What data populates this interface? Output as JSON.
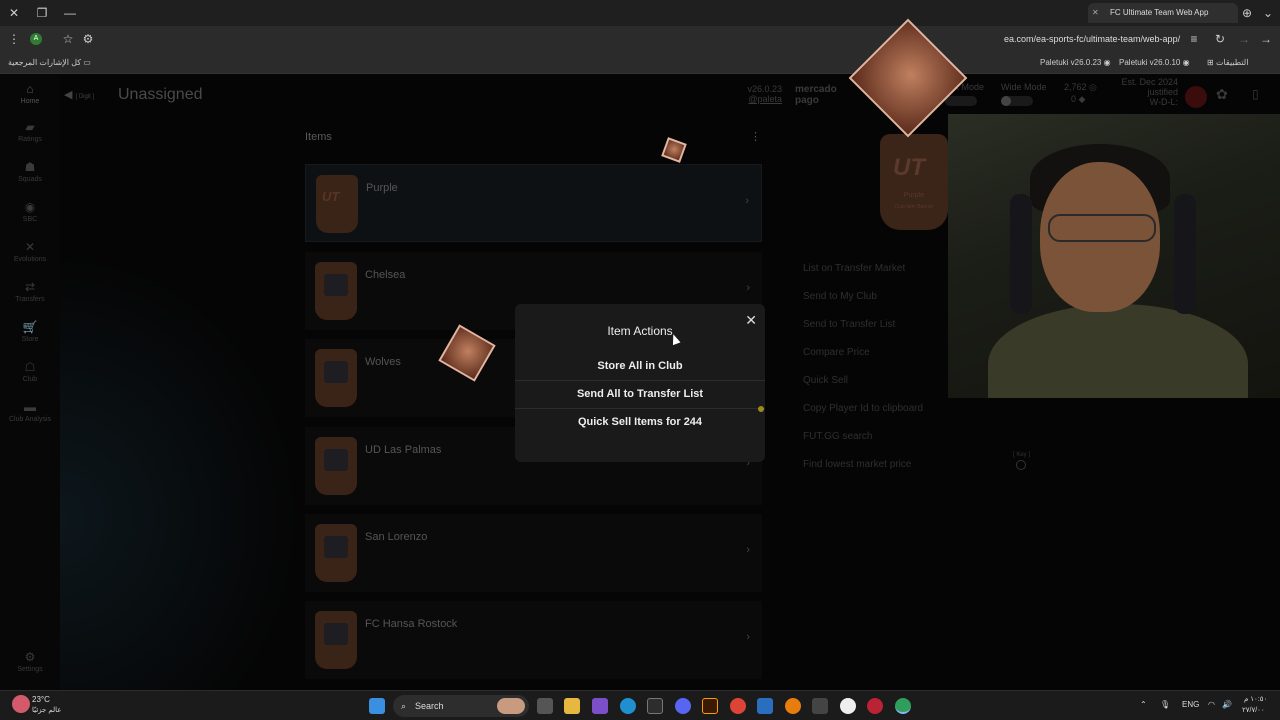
{
  "browser": {
    "tab_title": "FC Ultimate Team Web App",
    "url": "ea.com/ea-sports-fc/ultimate-team/web-app/",
    "bookmarks_all_label": "كل الإشارات المرجعية",
    "bookmark_1": "Paletuki v26.0.23",
    "bookmark_2": "Paletuki v26.0.10",
    "apps_label": "التطبيقات"
  },
  "app": {
    "page_title": "Unassigned",
    "back_label": "[ Digit ]",
    "version": "v26.0.23",
    "author": "@paleta",
    "sponsor": "mercado pago",
    "mode_label_1": "Dark Mode",
    "mode_label_2": "Wide Mode",
    "coins": "2,762",
    "points": "0",
    "est_label": "Est. Dec 2024",
    "est_sub": "justified",
    "wdl_label": "W-D-L:",
    "nav": [
      {
        "label": "Home"
      },
      {
        "label": "Ratings"
      },
      {
        "label": "Squads"
      },
      {
        "label": "SBC"
      },
      {
        "label": "Evolutions"
      },
      {
        "label": "Transfers"
      },
      {
        "label": "Store"
      },
      {
        "label": "Club"
      },
      {
        "label": "Club Analysis"
      },
      {
        "label": "Settings"
      }
    ],
    "items_header": "Items",
    "items": [
      {
        "name": "Purple"
      },
      {
        "name": "Chelsea"
      },
      {
        "name": "Wolves"
      },
      {
        "name": "UD Las Palmas"
      },
      {
        "name": "San Lorenzo"
      },
      {
        "name": "FC Hansa Rostock"
      }
    ],
    "big_card_label": "Purple",
    "big_card_sub": "Club Item Banner",
    "actions": [
      "List on Transfer Market",
      "Send to My Club",
      "Send to Transfer List",
      "Compare Price",
      "Quick Sell",
      "Copy Player Id to clipboard",
      "FUT.GG search",
      "Find lowest market price"
    ],
    "key_hint": "[ Key ]"
  },
  "modal": {
    "title": "Item Actions",
    "buttons": [
      "Store All in Club",
      "Send All to Transfer List",
      "Quick Sell Items for 244"
    ]
  },
  "taskbar": {
    "weather_temp": "23°C",
    "weather_text": "عالم جزئيًا",
    "search_placeholder": "Search",
    "lang": "ENG",
    "time": "١٠:٥٠ م",
    "date": "٢٧/٧/٠٠"
  }
}
